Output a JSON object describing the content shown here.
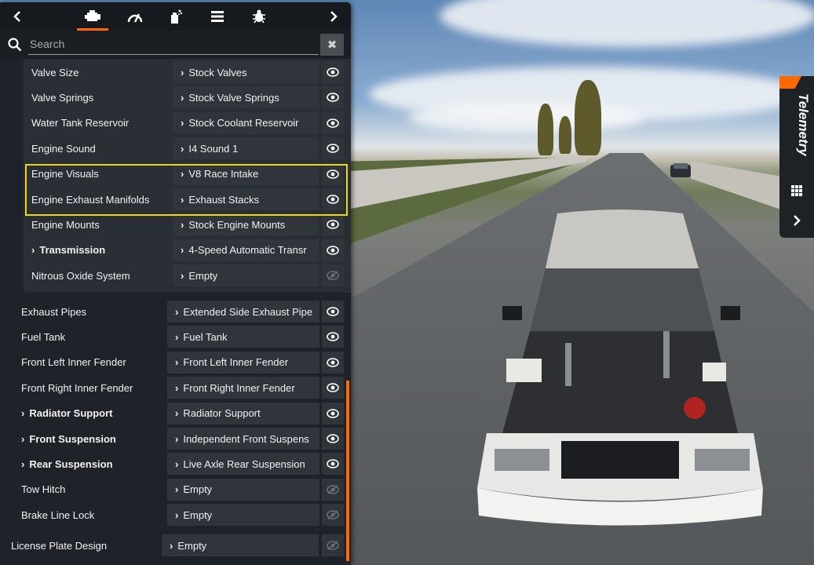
{
  "search": {
    "placeholder": "Search",
    "value": "",
    "clear_glyph": "✖"
  },
  "tabs": [
    {
      "icon": "engine-icon",
      "active": true
    },
    {
      "icon": "gauge-icon",
      "active": false
    },
    {
      "icon": "paint-spray-icon",
      "active": false
    },
    {
      "icon": "list-icon",
      "active": false
    },
    {
      "icon": "bug-icon",
      "active": false
    }
  ],
  "engine_subparts": [
    {
      "label": "Valve Size",
      "value": "Stock Valves",
      "visible": true
    },
    {
      "label": "Valve Springs",
      "value": "Stock Valve Springs",
      "visible": true
    },
    {
      "label": "Water Tank Reservoir",
      "value": "Stock Coolant Reservoir",
      "visible": true
    },
    {
      "label": "Engine Sound",
      "value": "I4 Sound 1",
      "visible": true
    },
    {
      "label": "Engine Visuals",
      "value": "V8 Race Intake",
      "visible": true
    },
    {
      "label": "Engine Exhaust Manifolds",
      "value": "Exhaust Stacks",
      "visible": true
    },
    {
      "label": "Engine Mounts",
      "value": "Stock Engine Mounts",
      "visible": true
    },
    {
      "label": "Transmission",
      "value": "4-Speed Automatic Transr",
      "visible": true,
      "expandable": true
    },
    {
      "label": "Nitrous Oxide System",
      "value": "Empty",
      "visible": false
    }
  ],
  "body_parts": [
    {
      "label": "Exhaust Pipes",
      "value": "Extended Side Exhaust Pipe",
      "visible": true
    },
    {
      "label": "Fuel Tank",
      "value": "Fuel Tank",
      "visible": true
    },
    {
      "label": "Front Left Inner Fender",
      "value": "Front Left Inner Fender",
      "visible": true
    },
    {
      "label": "Front Right Inner Fender",
      "value": "Front Right Inner Fender",
      "visible": true
    },
    {
      "label": "Radiator Support",
      "value": "Radiator Support",
      "visible": true,
      "expandable": true
    },
    {
      "label": "Front Suspension",
      "value": "Independent Front Suspens",
      "visible": true,
      "expandable": true
    },
    {
      "label": "Rear Suspension",
      "value": "Live Axle Rear Suspension",
      "visible": true,
      "expandable": true
    },
    {
      "label": "Tow Hitch",
      "value": "Empty",
      "visible": false
    },
    {
      "label": "Brake Line Lock",
      "value": "Empty",
      "visible": false
    }
  ],
  "top_parts": [
    {
      "label": "License Plate Design",
      "value": "Empty",
      "visible": false
    }
  ],
  "telemetry": {
    "label": "Telemetry"
  },
  "colors": {
    "accent": "#ff6a00",
    "highlight": "#f2d50f",
    "panel": "#1f2329"
  }
}
